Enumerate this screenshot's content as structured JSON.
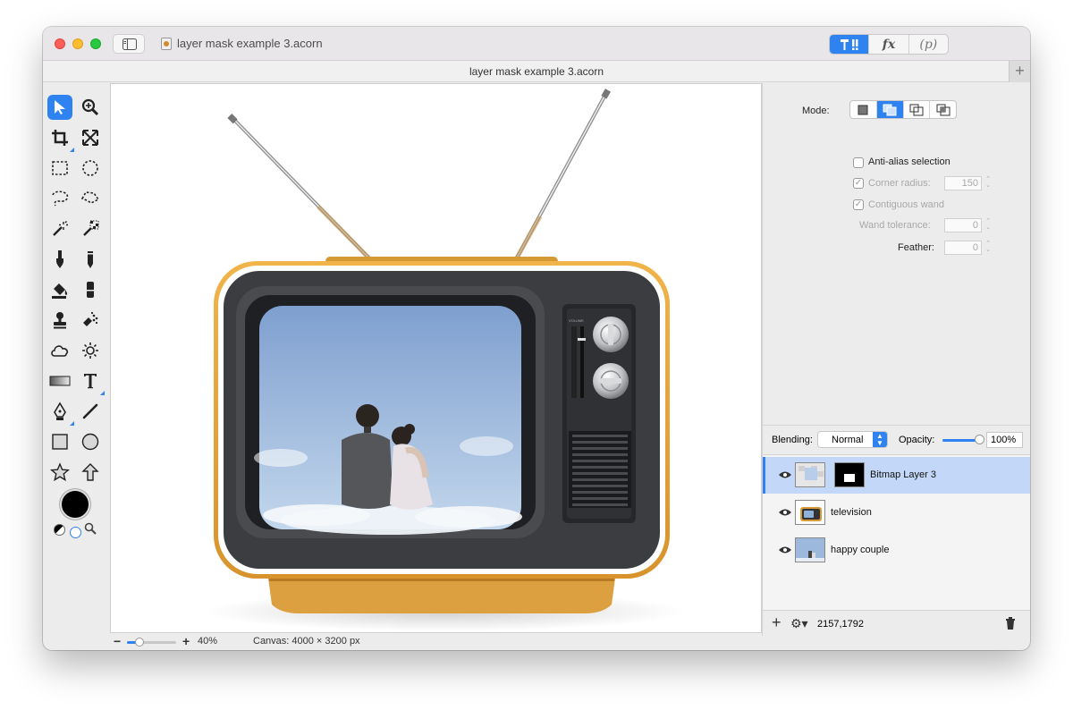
{
  "window": {
    "title": "layer mask example 3.acorn",
    "document_title": "layer mask example 3.acorn",
    "add_tab_label": "+"
  },
  "mode_switch": {
    "tools_label": "T!",
    "fx_label": "fx",
    "p_label": "(p)",
    "selected": "tools"
  },
  "toolbox": {
    "tools": [
      "select-arrow",
      "zoom",
      "crop",
      "transform",
      "rect-select",
      "ellipse-select",
      "lasso",
      "polygon-lasso",
      "magic-wand",
      "color-wand",
      "brush",
      "pencil",
      "paint-bucket",
      "eraser",
      "clone-stamp",
      "smudge",
      "shape-cloud",
      "sun-effect",
      "gradient",
      "text",
      "bezier-pen",
      "line",
      "rectangle",
      "circle",
      "star",
      "arrow"
    ],
    "selected": "select-arrow",
    "foreground_color": "#000000",
    "background_color": "#ffffff"
  },
  "inspector": {
    "mode_label": "Mode:",
    "mode_selected_index": 1,
    "anti_alias_label": "Anti-alias selection",
    "anti_alias_checked": false,
    "corner_radius_label": "Corner radius:",
    "corner_radius_value": "150",
    "corner_radius_checked": true,
    "contiguous_wand_label": "Contiguous wand",
    "contiguous_wand_checked": true,
    "wand_tolerance_label": "Wand tolerance:",
    "wand_tolerance_value": "0",
    "feather_label": "Feather:",
    "feather_value": "0"
  },
  "layers_panel": {
    "blending_label": "Blending:",
    "blending_value": "Normal",
    "opacity_label": "Opacity:",
    "opacity_value": "100%",
    "opacity_fraction": 1.0,
    "layers": [
      {
        "name": "Bitmap Layer 3",
        "selected": true,
        "visible": true,
        "has_mask": true
      },
      {
        "name": "television",
        "selected": false,
        "visible": true,
        "has_mask": false
      },
      {
        "name": "happy couple",
        "selected": false,
        "visible": true,
        "has_mask": false
      }
    ],
    "cursor_coords": "2157,1792"
  },
  "status": {
    "zoom_minus": "−",
    "zoom_plus": "+",
    "zoom_value": "40%",
    "canvas_size": "Canvas: 4000 × 3200 px"
  },
  "colors": {
    "accent": "#2f83f1",
    "tv_body": "#e3a53c",
    "tv_bezel": "#3c3d40",
    "sky_top": "#7e9fcf",
    "sky_bottom": "#c3d7ec"
  }
}
